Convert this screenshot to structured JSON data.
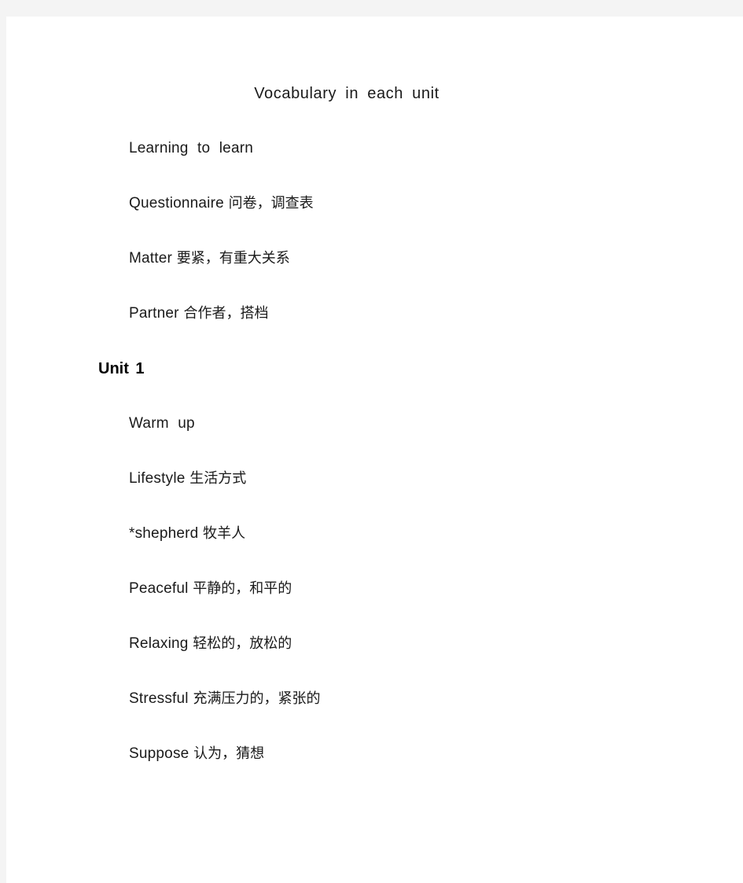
{
  "document": {
    "title": "Vocabulary in each unit",
    "page_background": "#ffffff",
    "backdrop_color": "#f4f4f4",
    "text_color": "#1a1a1a"
  },
  "sections": [
    {
      "heading": null,
      "entries": [
        {
          "term": "Learning to learn",
          "gloss": ""
        },
        {
          "term": "Questionnaire",
          "gloss": " 问卷，调查表"
        },
        {
          "term": "Matter",
          "gloss": " 要紧，有重大关系"
        },
        {
          "term": "Partner",
          "gloss": " 合作者，搭档"
        }
      ]
    },
    {
      "heading": "Unit 1",
      "entries": [
        {
          "term": "Warm up",
          "gloss": ""
        },
        {
          "term": "Lifestyle",
          "gloss": " 生活方式"
        },
        {
          "term": "*shepherd",
          "gloss": " 牧羊人"
        },
        {
          "term": "Peaceful",
          "gloss": " 平静的，和平的"
        },
        {
          "term": "Relaxing",
          "gloss": " 轻松的，放松的"
        },
        {
          "term": "Stressful",
          "gloss": " 充满压力的，紧张的"
        },
        {
          "term": "Suppose",
          "gloss": " 认为，猜想"
        }
      ]
    }
  ]
}
